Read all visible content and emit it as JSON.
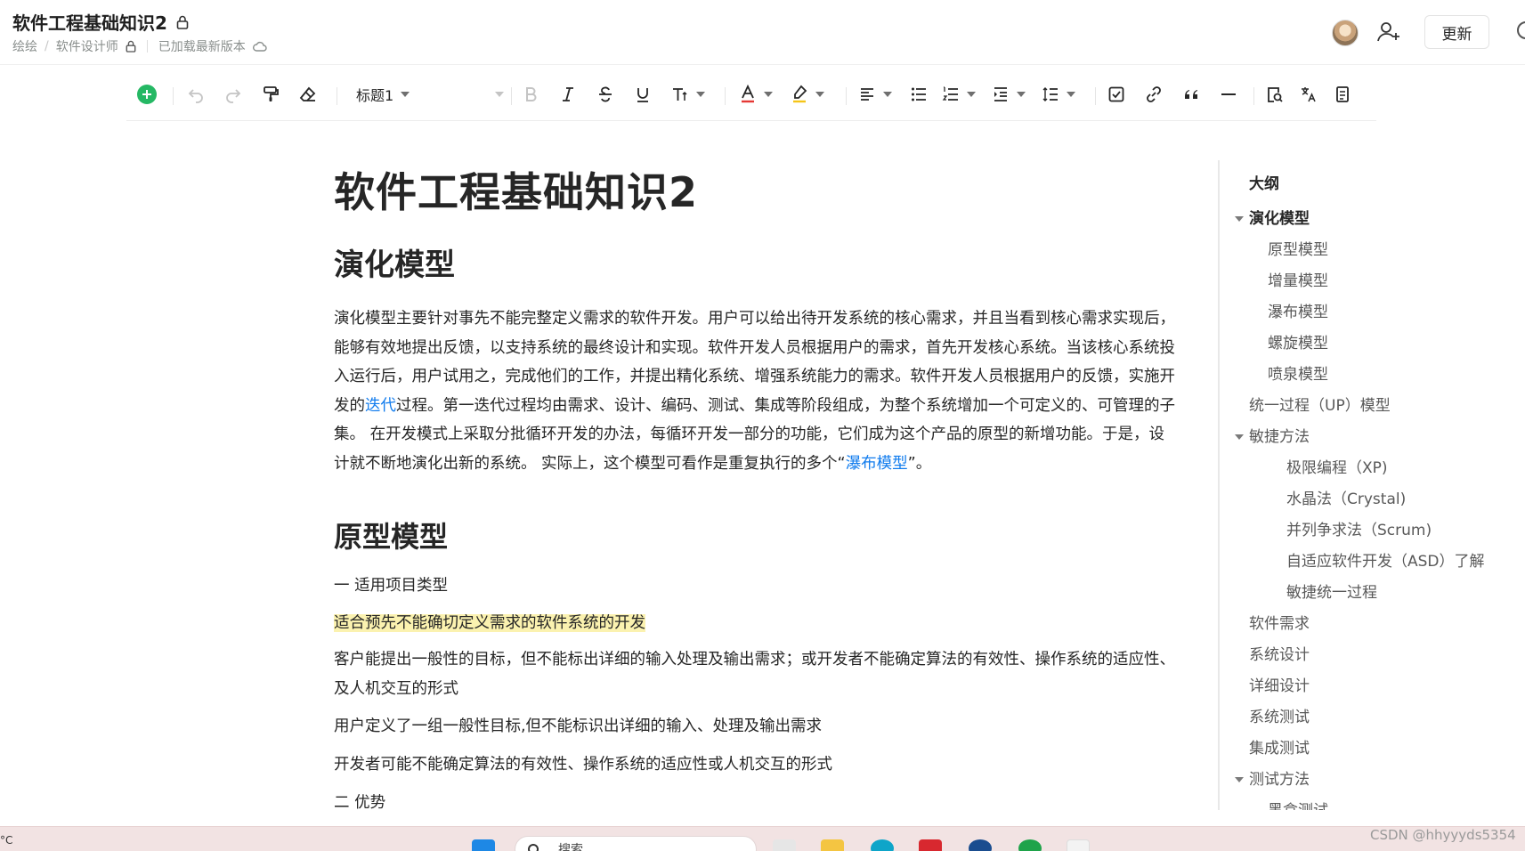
{
  "header": {
    "title": "软件工程基础知识2",
    "breadcrumb": [
      "绘绘",
      "软件设计师"
    ],
    "status": "已加载最新版本",
    "update_label": "更新"
  },
  "toolbar": {
    "heading_style": "标题1",
    "color_accent": "#25b864"
  },
  "doc": {
    "title": "软件工程基础知识2",
    "h2_1": "演化模型",
    "p1_a": "演化模型主要针对事先不能完整定义需求的软件开发。用户可以给出待开发系统的核心需求，并且当看到核心需求实现后，能够有效地提出反馈，以支持系统的最终设计和实现。软件开发人员根据用户的需求，首先开发核心系统。当该核心系统投入运行后，用户试用之，完成他们的工作，并提出精化系统、增强系统能力的需求。软件开发人员根据用户的反馈，实施开发的",
    "p1_link1": "迭代",
    "p1_b": "过程。第一迭代过程均由需求、设计、编码、测试、集成等阶段组成，为整个系统增加一个可定义的、可管理的子集。 在开发模式上采取分批循环开发的办法，每循环开发一部分的功能，它们成为这个产品的原型的新增功能。于是，设计就不断地演化出新的系统。 实际上，这个模型可看作是重复执行的多个“",
    "p1_link2": "瀑布模型",
    "p1_c": "”。",
    "h2_2": "原型模型",
    "l1": "一 适用项目类型",
    "l2": "适合预先不能确切定义需求的软件系统的开发",
    "l3": "客户能提出一般性的目标，但不能标出详细的输入处理及输出需求；或开发者不能确定算法的有效性、操作系统的适应性、及人机交互的形式",
    "l4": "用户定义了一组一般性目标,但不能标识出详细的输入、处理及输出需求",
    "l5": "开发者可能不能确定算法的有效性、操作系统的适应性或人机交互的形式",
    "l6": "二 优势"
  },
  "outline": {
    "title": "大纲",
    "items": [
      {
        "label": "演化模型",
        "level": 1,
        "bold": true,
        "expanded": true
      },
      {
        "label": "原型模型",
        "level": 2
      },
      {
        "label": "增量模型",
        "level": 2
      },
      {
        "label": "瀑布模型",
        "level": 2
      },
      {
        "label": "螺旋模型",
        "level": 2
      },
      {
        "label": "喷泉模型",
        "level": 2
      },
      {
        "label": "统一过程（UP）模型",
        "level": 1
      },
      {
        "label": "敏捷方法",
        "level": 1,
        "expanded": true
      },
      {
        "label": "极限编程（XP)",
        "level": 3
      },
      {
        "label": "水晶法（Crystal)",
        "level": 3
      },
      {
        "label": "并列争求法（Scrum)",
        "level": 3
      },
      {
        "label": "自适应软件开发（ASD）了解",
        "level": 3
      },
      {
        "label": "敏捷统一过程",
        "level": 3
      },
      {
        "label": "软件需求",
        "level": 1
      },
      {
        "label": "系统设计",
        "level": 1
      },
      {
        "label": "详细设计",
        "level": 1
      },
      {
        "label": "系统测试",
        "level": 1
      },
      {
        "label": "集成测试",
        "level": 1
      },
      {
        "label": "测试方法",
        "level": 1,
        "expanded": true
      },
      {
        "label": "黑盒测试",
        "level": 2
      }
    ]
  },
  "taskbar": {
    "temp": "°C",
    "search_placeholder": "搜索"
  },
  "watermark": "CSDN @hhyyyds5354"
}
